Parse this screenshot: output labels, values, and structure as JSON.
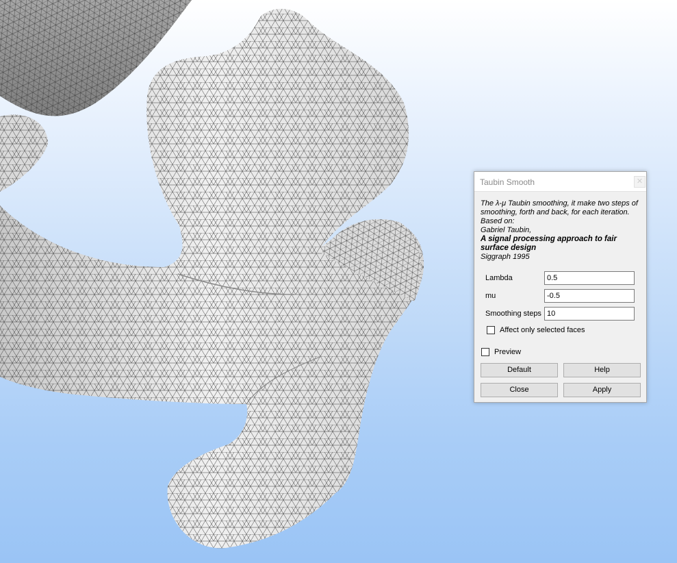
{
  "dialog": {
    "title": "Taubin Smooth",
    "description": {
      "line1": "The λ-μ Taubin smoothing, it make two steps of",
      "line2": "smoothing, forth and back, for each iteration.",
      "based_on": "Based on:",
      "author": "Gabriel Taubin,",
      "paper_line1": "A signal processing approach to fair",
      "paper_line2": "surface design",
      "venue": "Siggraph 1995"
    },
    "fields": {
      "lambda": {
        "label": "Lambda",
        "value": "0.5"
      },
      "mu": {
        "label": "mu",
        "value": "-0.5"
      },
      "steps": {
        "label": "Smoothing steps",
        "value": "10"
      }
    },
    "checkboxes": {
      "affect_selected": "Affect only selected faces",
      "preview": "Preview"
    },
    "buttons": {
      "default": "Default",
      "help": "Help",
      "close": "Close",
      "apply": "Apply"
    }
  },
  "colors": {
    "mesh_fill": "#ececec",
    "mesh_edge": "#2b2b2b",
    "background_top": "#ffffff",
    "background_bottom": "#9ac4f5"
  }
}
